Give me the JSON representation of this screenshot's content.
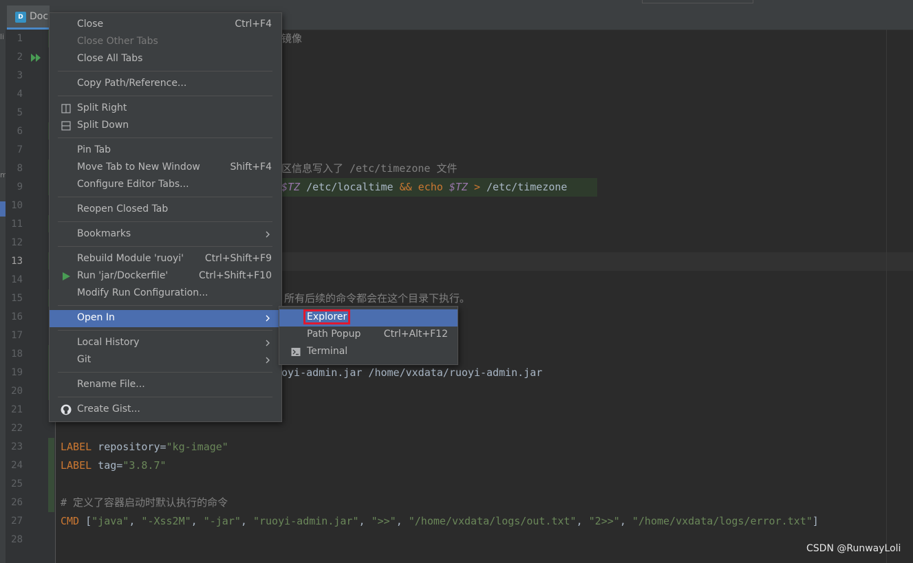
{
  "editor_tab": {
    "label": "Doc",
    "icon": "docker-file-icon"
  },
  "left_panel": {
    "fragment_top": "li",
    "fragment_mid": "m"
  },
  "line_numbers": [
    "1",
    "2",
    "3",
    "4",
    "5",
    "6",
    "7",
    "8",
    "9",
    "10",
    "11",
    "12",
    "13",
    "14",
    "15",
    "16",
    "17",
    "18",
    "19",
    "20",
    "21",
    "22",
    "23",
    "24",
    "25",
    "26",
    "27",
    "28"
  ],
  "current_line": "13",
  "code": {
    "l1_visible": "镜像",
    "l8_visible": "区信息写入了 /etc/timezone 文件",
    "l9": {
      "v1": "$TZ",
      "t1": " /etc/localtime ",
      "and": "&&",
      "echo": " echo ",
      "v2": "$TZ",
      "gt": " > ",
      "t2": "/etc/timezone"
    },
    "l15_visible": "所有后续的命令都会在这个目录下执行。",
    "l19_visible": "oyi-admin.jar /home/vxdata/ruoyi-admin.jar",
    "l23": {
      "kw": "LABEL",
      "key": " repository=",
      "val": "\"kg-image\""
    },
    "l24": {
      "kw": "LABEL",
      "key": " tag=",
      "val": "\"3.8.7\""
    },
    "l26": "# 定义了容器启动时默认执行的命令",
    "l27": {
      "kw": "CMD",
      "open": " [",
      "s1": "\"java\"",
      "s2": "\"-Xss2M\"",
      "s3": "\"-jar\"",
      "s4": "\"ruoyi-admin.jar\"",
      "s5": "\">>\"",
      "s6": "\"/home/vxdata/logs/out.txt\"",
      "s7": "\"2>>\"",
      "s8": "\"/home/vxdata/logs/error.txt\"",
      "comma": ", ",
      "close": "]"
    }
  },
  "context_menu": {
    "close": {
      "label": "Close",
      "shortcut": "Ctrl+F4"
    },
    "close_other": "Close Other Tabs",
    "close_all": "Close All Tabs",
    "copy_path": "Copy Path/Reference...",
    "split_right": "Split Right",
    "split_down": "Split Down",
    "pin_tab": "Pin Tab",
    "move_tab": {
      "label": "Move Tab to New Window",
      "shortcut": "Shift+F4"
    },
    "configure_tabs": "Configure Editor Tabs...",
    "reopen_closed": "Reopen Closed Tab",
    "bookmarks": "Bookmarks",
    "rebuild": {
      "label": "Rebuild Module 'ruoyi'",
      "shortcut": "Ctrl+Shift+F9"
    },
    "run": {
      "label": "Run 'jar/Dockerfile'",
      "shortcut": "Ctrl+Shift+F10"
    },
    "modify_run": "Modify Run Configuration...",
    "open_in": "Open In",
    "local_history": "Local History",
    "git": "Git",
    "rename": "Rename File...",
    "create_gist": "Create Gist..."
  },
  "submenu": {
    "explorer": "Explorer",
    "path_popup": {
      "label": "Path Popup",
      "shortcut": "Ctrl+Alt+F12"
    },
    "terminal": "Terminal"
  },
  "watermark": "CSDN @RunwayLoli",
  "colors": {
    "menu_bg": "#3c3f41",
    "selection": "#4b6eaf",
    "highlight_box": "#e0192f",
    "editor_bg": "#2b2b2b"
  }
}
